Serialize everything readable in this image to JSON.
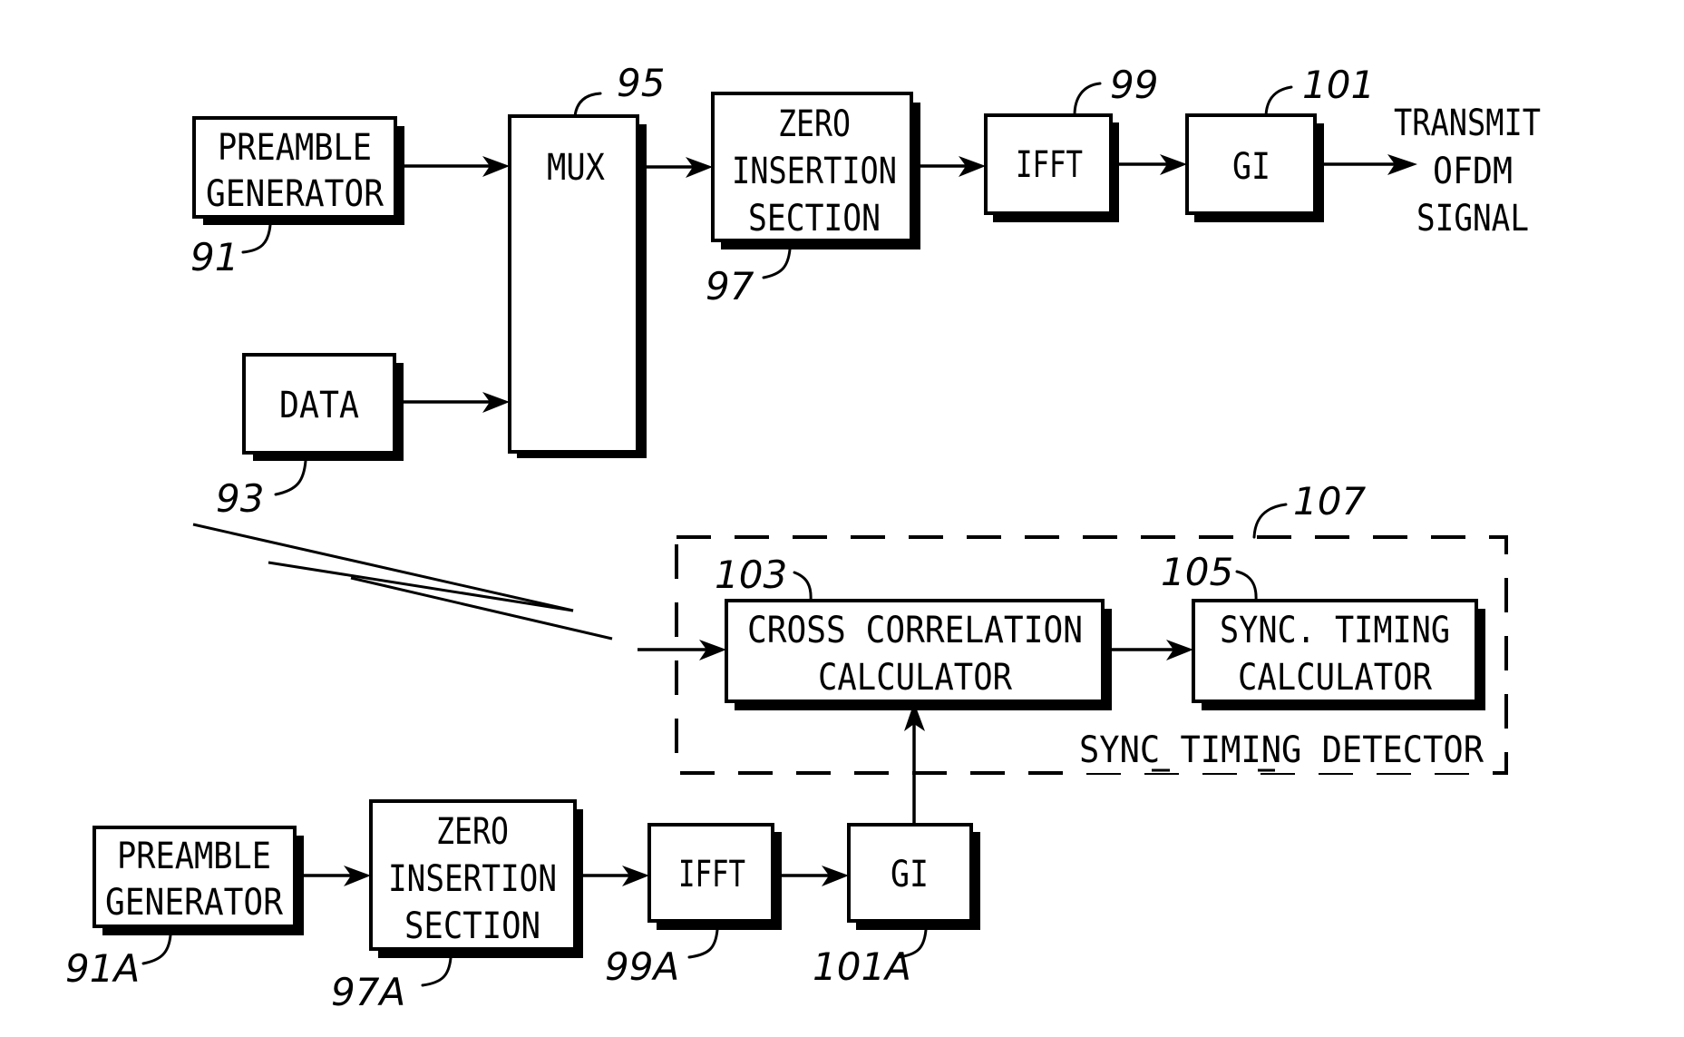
{
  "figure": {
    "transmitter": {
      "preamble_generator": {
        "ref": "91",
        "lines": [
          "PREAMBLE",
          "GENERATOR"
        ]
      },
      "data": {
        "ref": "93",
        "lines": [
          "DATA"
        ]
      },
      "mux": {
        "ref": "95",
        "lines": [
          "MUX"
        ]
      },
      "zero_insertion": {
        "ref": "97",
        "lines": [
          "ZERO",
          "INSERTION",
          "SECTION"
        ]
      },
      "ifft": {
        "ref": "99",
        "lines": [
          "IFFT"
        ]
      },
      "gi": {
        "ref": "101",
        "lines": [
          "GI"
        ]
      },
      "output_label": [
        "TRANSMIT",
        "OFDM",
        "SIGNAL"
      ]
    },
    "sync_timing_detector": {
      "ref": "107",
      "caption": "SYNC TIMING DETECTOR",
      "cross_correlation": {
        "ref": "103",
        "lines": [
          "CROSS CORRELATION",
          "CALCULATOR"
        ]
      },
      "sync_timing_calc": {
        "ref": "105",
        "lines": [
          "SYNC. TIMING",
          "CALCULATOR"
        ]
      }
    },
    "replica": {
      "preamble_generator": {
        "ref": "91A",
        "lines": [
          "PREAMBLE",
          "GENERATOR"
        ]
      },
      "zero_insertion": {
        "ref": "97A",
        "lines": [
          "ZERO",
          "INSERTION",
          "SECTION"
        ]
      },
      "ifft": {
        "ref": "99A",
        "lines": [
          "IFFT"
        ]
      },
      "gi": {
        "ref": "101A",
        "lines": [
          "GI"
        ]
      }
    }
  }
}
